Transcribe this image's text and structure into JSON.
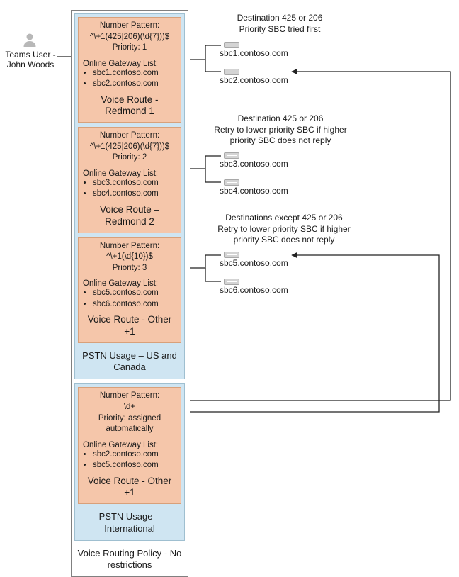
{
  "user": {
    "label": "Teams User - John Woods"
  },
  "policy": {
    "title": "Voice Routing Policy - No restrictions"
  },
  "usages": {
    "us_canada": {
      "title": "PSTN Usage – US and Canada",
      "routes": {
        "redmond1": {
          "pattern_label": "Number Pattern:",
          "pattern": "^\\+1(425|206)(\\d{7}))$",
          "priority": "Priority: 1",
          "gw_label": "Online Gateway List:",
          "gateways": [
            "sbc1.contoso.com",
            "sbc2.contoso.com"
          ],
          "title": "Voice Route - Redmond 1"
        },
        "redmond2": {
          "pattern_label": "Number Pattern:",
          "pattern": "^\\+1(425|206)(\\d{7}))$",
          "priority": "Priority: 2",
          "gw_label": "Online Gateway List:",
          "gateways": [
            "sbc3.contoso.com",
            "sbc4.contoso.com"
          ],
          "title": "Voice Route – Redmond 2"
        },
        "other1": {
          "pattern_label": "Number Pattern:",
          "pattern": "^\\+1(\\d{10})$",
          "priority": "Priority: 3",
          "gw_label": "Online Gateway List:",
          "gateways": [
            "sbc5.contoso.com",
            "sbc6.contoso.com"
          ],
          "title": "Voice Route - Other +1"
        }
      }
    },
    "international": {
      "title": "PSTN Usage – International",
      "routes": {
        "other1": {
          "pattern_label": "Number Pattern:",
          "pattern": "\\d+",
          "priority": "Priority: assigned automatically",
          "gw_label": "Online Gateway List:",
          "gateways": [
            "sbc2.contoso.com",
            "sbc5.contoso.com"
          ],
          "title": "Voice Route - Other +1"
        }
      }
    }
  },
  "notes": {
    "group1": "Destination 425 or 206\nPriority SBC tried first",
    "group2": "Destination 425 or 206\nRetry to lower priority SBC if higher priority SBC does not reply",
    "group3": "Destinations except 425 or 206\nRetry to lower priority SBC if higher priority SBC does not reply"
  },
  "sbcs": {
    "sbc1": "sbc1.contoso.com",
    "sbc2": "sbc2.contoso.com",
    "sbc3": "sbc3.contoso.com",
    "sbc4": "sbc4.contoso.com",
    "sbc5": "sbc5.contoso.com",
    "sbc6": "sbc6.contoso.com"
  }
}
